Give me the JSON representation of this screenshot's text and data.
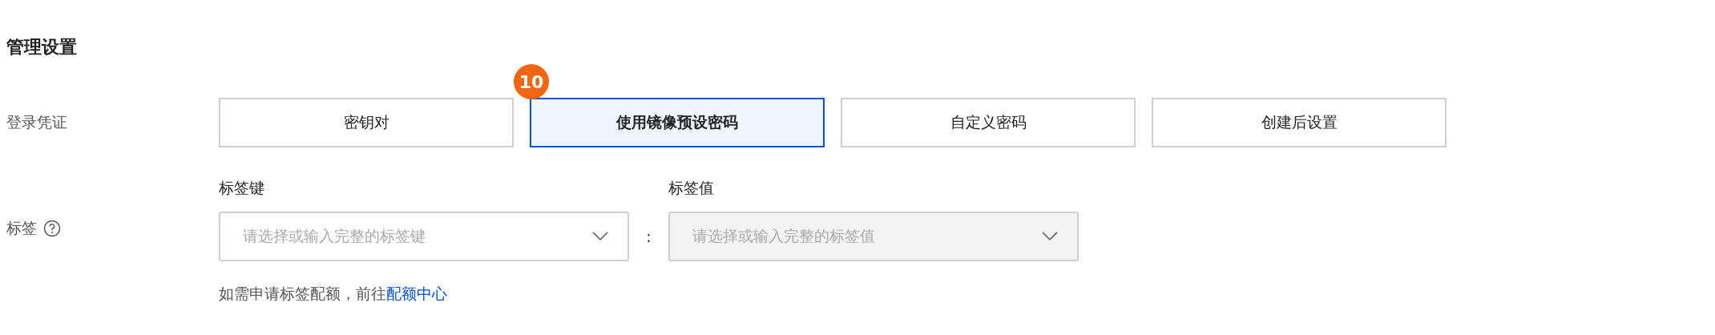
{
  "section_title": "管理设置",
  "login": {
    "label": "登录凭证",
    "options": [
      {
        "label": "密钥对",
        "selected": false
      },
      {
        "label": "使用镜像预设密码",
        "selected": true,
        "badge": "10"
      },
      {
        "label": "自定义密码",
        "selected": false
      },
      {
        "label": "创建后设置",
        "selected": false
      }
    ]
  },
  "tags": {
    "label": "标签",
    "key": {
      "label": "标签键",
      "placeholder": "请选择或输入完整的标签键",
      "disabled": false
    },
    "separator": ":",
    "value": {
      "label": "标签值",
      "placeholder": "请选择或输入完整的标签值",
      "disabled": true
    },
    "hint": "如需申请标签配额，前往",
    "hint_link": "配额中心"
  }
}
